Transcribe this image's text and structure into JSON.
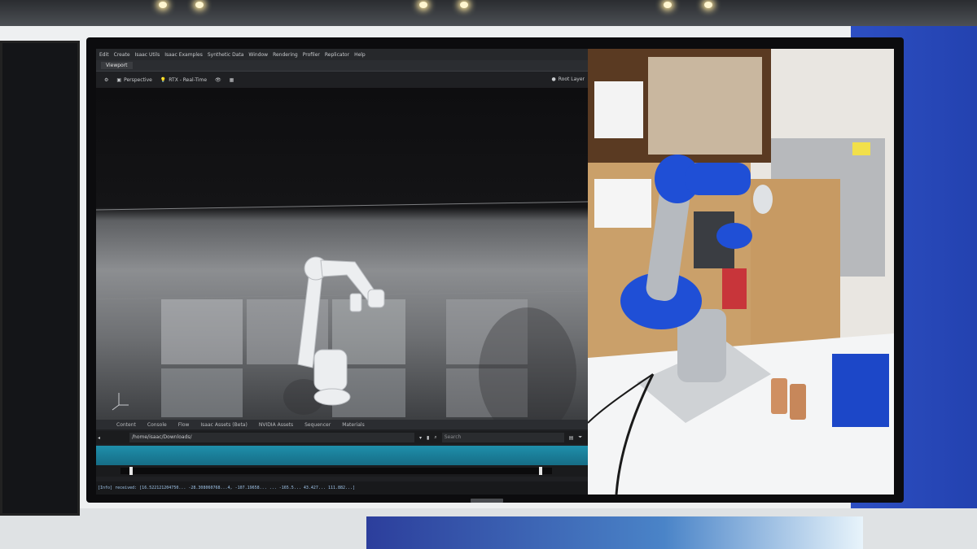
{
  "menu": [
    "Edit",
    "Create",
    "Isaac Utils",
    "Isaac Examples",
    "Synthetic Data",
    "Window",
    "Rendering",
    "Profiler",
    "Replicator",
    "Help"
  ],
  "viewport_tab": "Viewport",
  "toolbar": {
    "camera": "Perspective",
    "renderer": "RTX - Real-Time",
    "root_layer": "Root Layer"
  },
  "bottom_tabs": [
    "Content",
    "Console",
    "Flow",
    "Isaac Assets (Beta)",
    "NVIDIA Assets",
    "Sequencer",
    "Materials"
  ],
  "path": {
    "value": "/home/isaac/Downloads/",
    "search_placeholder": "Search"
  },
  "timeline": {
    "playhead_fraction": 0.02,
    "end_fraction": 0.97
  },
  "console_line": "[Info] received: [16.522121204750... -28.308060768...4, -107.19658... ... -165.5... 43.427... 111.882...]",
  "colors": {
    "accent_teal": "#1f8fab",
    "robot_blue": "#1f4fd6",
    "brand_panel": "#2342b0"
  }
}
